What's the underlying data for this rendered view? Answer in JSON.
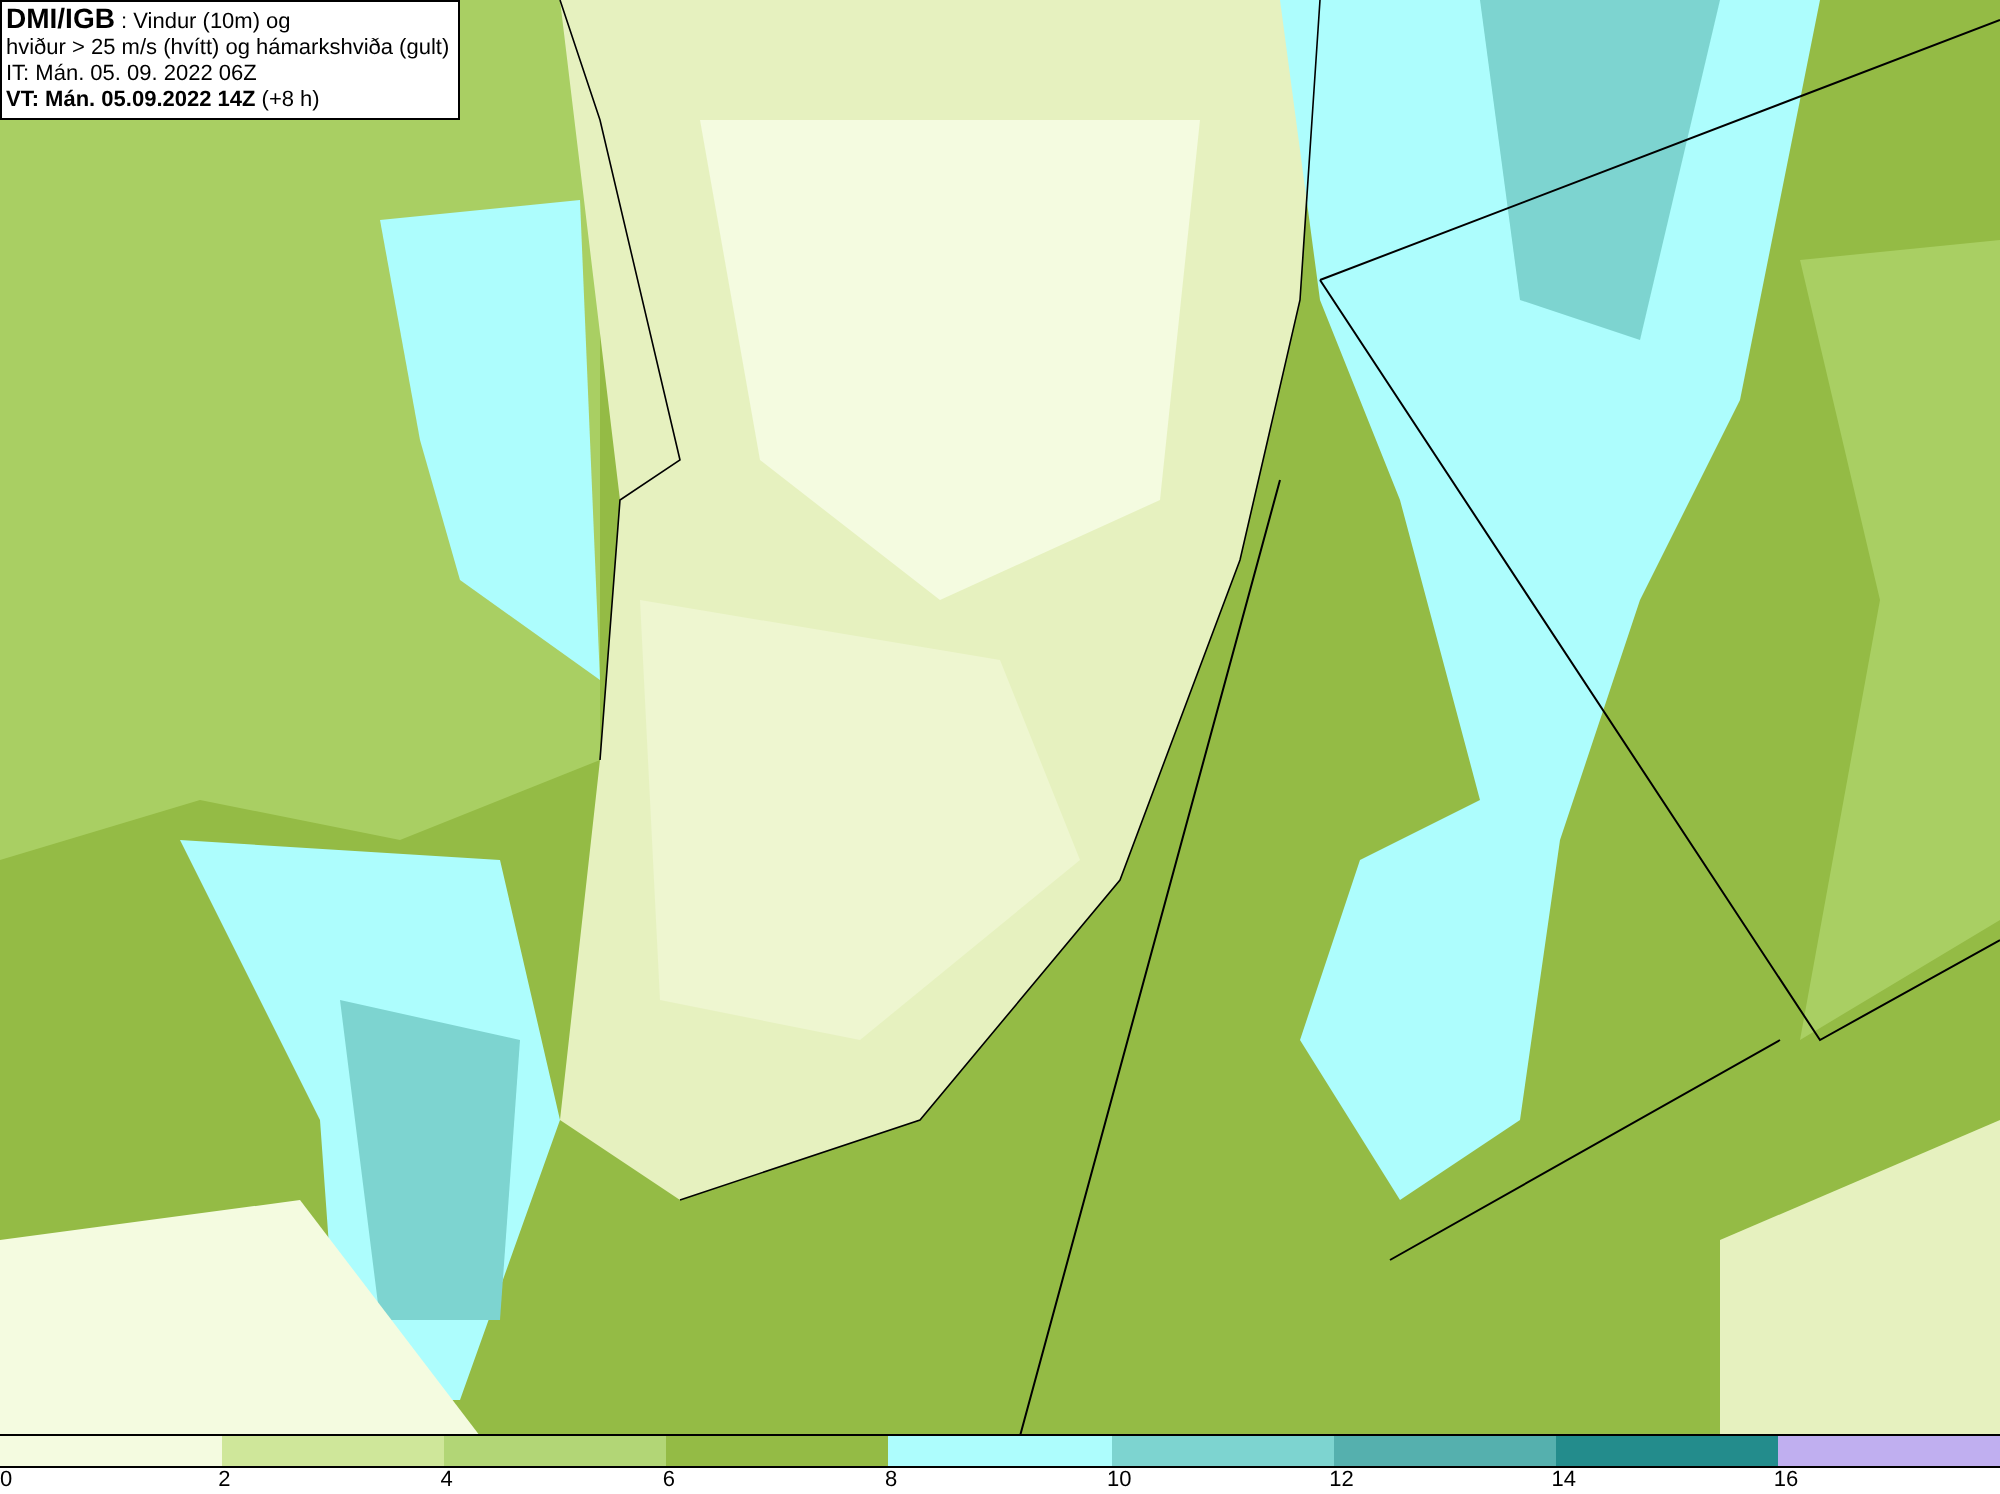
{
  "title_box": {
    "lines": [
      "**DMI/IGB** : Vindur (10m) og",
      "hviður > 25 m/s (hvítt) og hámarkshviða (gult)",
      "IT: Mán. 05. 09. 2022 06Z",
      "**VT: Mán. 05.09.2022 14Z** (+8 h)"
    ]
  },
  "legend": {
    "segments": [
      {
        "color": "#f4fbe0"
      },
      {
        "color": "#cfe79a"
      },
      {
        "color": "#b2d676"
      },
      {
        "color": "#94bb45"
      },
      {
        "color": "#adfdfd"
      },
      {
        "color": "#7dd4d0"
      },
      {
        "color": "#55b0ae"
      },
      {
        "color": "#238c8c"
      },
      {
        "color": "#c0aff0"
      }
    ],
    "ticks": [
      "0",
      "2",
      "4",
      "6",
      "8",
      "10",
      "12",
      "14",
      "16"
    ]
  }
}
